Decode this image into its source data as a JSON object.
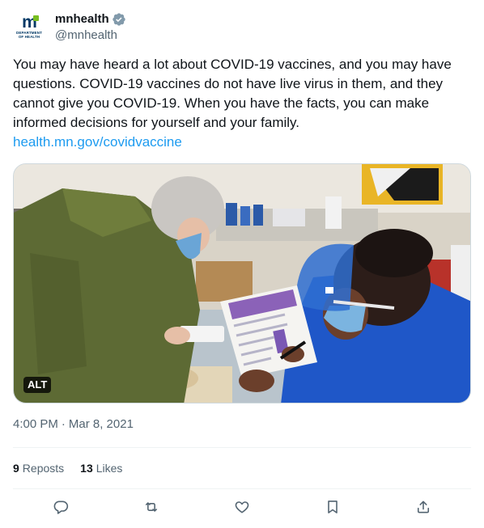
{
  "account": {
    "display_name": "mnhealth",
    "handle": "@mnhealth",
    "avatar_mark": "m",
    "avatar_sub_line1": "DEPARTMENT",
    "avatar_sub_line2": "OF HEALTH",
    "verified": true
  },
  "tweet": {
    "text": "You may have heard a lot about COVID-19 vaccines, and you may have questions. COVID-19 vaccines do not have live virus in them, and they cannot give you COVID-19. When you have the facts, you can make informed decisions for yourself and your family.",
    "link": "health.mn.gov/covidvaccine",
    "media_alt_badge": "ALT",
    "time": "4:00 PM",
    "separator": "·",
    "date": "Mar 8, 2021"
  },
  "stats": {
    "reposts_count": "9",
    "reposts_label": "Reposts",
    "likes_count": "13",
    "likes_label": "Likes"
  },
  "actions": [
    "reply-icon",
    "repost-icon",
    "like-icon",
    "bookmark-icon",
    "share-icon"
  ],
  "colors": {
    "link": "#1d9bf0",
    "secondary_text": "#536471",
    "primary_text": "#0f1419",
    "brand_blue": "#003865",
    "brand_green": "#78be21"
  }
}
